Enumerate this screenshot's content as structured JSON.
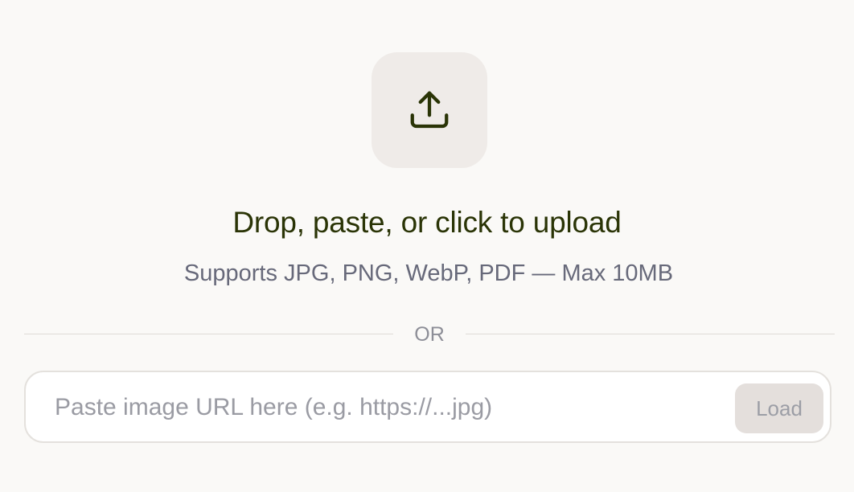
{
  "upload": {
    "icon": "upload-icon",
    "headline": "Drop, paste, or click to upload",
    "supported_formats": "Supports JPG, PNG, WebP, PDF — Max 10MB"
  },
  "divider": {
    "label": "OR"
  },
  "url_form": {
    "placeholder": "Paste image URL here (e.g. https://...jpg)",
    "value": "",
    "load_label": "Load"
  },
  "colors": {
    "background": "#faf9f7",
    "icon_tile": "#efebe8",
    "icon_stroke": "#2a3406",
    "headline": "#2a3406",
    "subtext": "#67697a",
    "button_bg": "#e4dfdc",
    "button_text": "#9c9ea6"
  }
}
